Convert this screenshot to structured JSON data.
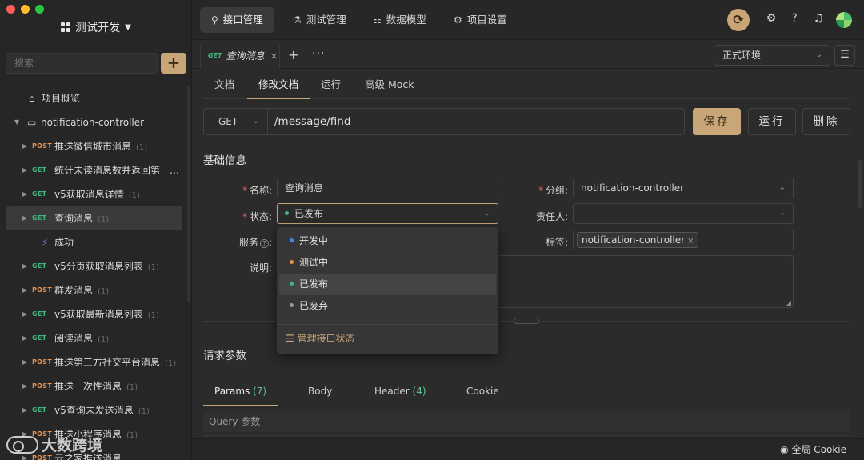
{
  "sidebar": {
    "team_name": "测试开发",
    "search_placeholder": "搜索",
    "add_label": "+",
    "overview_label": "项目概览",
    "folder_label": "notification-controller",
    "items": [
      {
        "method": "POST",
        "name": "推送微信城市消息",
        "count": "(1)"
      },
      {
        "method": "GET",
        "name": "统计未读消息数并返回第一…",
        "count": ""
      },
      {
        "method": "GET",
        "name": "v5获取消息详情",
        "count": "(1)"
      },
      {
        "method": "GET",
        "name": "查询消息",
        "count": "(1)"
      },
      {
        "method": "GET",
        "name": "v5分页获取消息列表",
        "count": "(1)"
      },
      {
        "method": "POST",
        "name": "群发消息",
        "count": "(1)"
      },
      {
        "method": "GET",
        "name": "v5获取最新消息列表",
        "count": "(1)"
      },
      {
        "method": "GET",
        "name": "阅读消息",
        "count": "(1)"
      },
      {
        "method": "POST",
        "name": "推送第三方社交平台消息",
        "count": "(1)"
      },
      {
        "method": "POST",
        "name": "推送一次性消息",
        "count": "(1)"
      },
      {
        "method": "GET",
        "name": "v5查询未发送消息",
        "count": "(1)"
      },
      {
        "method": "POST",
        "name": "推送小程序消息",
        "count": "(1)"
      },
      {
        "method": "POST",
        "name": "云之家推送消息",
        "count": ""
      }
    ],
    "case_label": "成功",
    "watermark": "大数跨境"
  },
  "topnav": {
    "tabs": [
      "接口管理",
      "测试管理",
      "数据模型",
      "项目设置"
    ]
  },
  "doc_tab": {
    "method": "GET",
    "title": "查询消息",
    "close": "×",
    "plus": "+",
    "more": "···"
  },
  "environment": {
    "selected": "正式环境"
  },
  "subtabs": [
    "文档",
    "修改文档",
    "运行",
    "高级 Mock"
  ],
  "request": {
    "method": "GET",
    "url": "/message/find",
    "save_label": "保存",
    "run_label": "运行",
    "delete_label": "删除"
  },
  "basic_info": {
    "title": "基础信息",
    "name_label": "名称:",
    "name_value": "查询消息",
    "status_label": "状态:",
    "status_value": "已发布",
    "service_label": "服务",
    "service_colon": ":",
    "desc_label": "说明:",
    "group_label": "分组:",
    "group_value": "notification-controller",
    "owner_label": "责任人:",
    "owner_value": "",
    "tags_label": "标签:",
    "tag_value": "notification-controller"
  },
  "status_dropdown": {
    "options": [
      {
        "label": "开发中",
        "color": "#3a8ee6"
      },
      {
        "label": "测试中",
        "color": "#e8924a"
      },
      {
        "label": "已发布",
        "color": "#45b57e"
      },
      {
        "label": "已废弃",
        "color": "#9a9a9a"
      }
    ],
    "selected_index": 2,
    "manage_label": "管理接口状态"
  },
  "params": {
    "section_title": "请求参数",
    "tabs": [
      {
        "label": "Params",
        "count": "(7)"
      },
      {
        "label": "Body",
        "count": ""
      },
      {
        "label": "Header",
        "count": "(4)"
      },
      {
        "label": "Cookie",
        "count": ""
      }
    ],
    "query_label": "Query 参数"
  },
  "footer": {
    "cookie_label": "全局 Cookie"
  },
  "colors": {
    "accent": "#c8a677",
    "get": "#45b57e",
    "post": "#e8924a"
  }
}
